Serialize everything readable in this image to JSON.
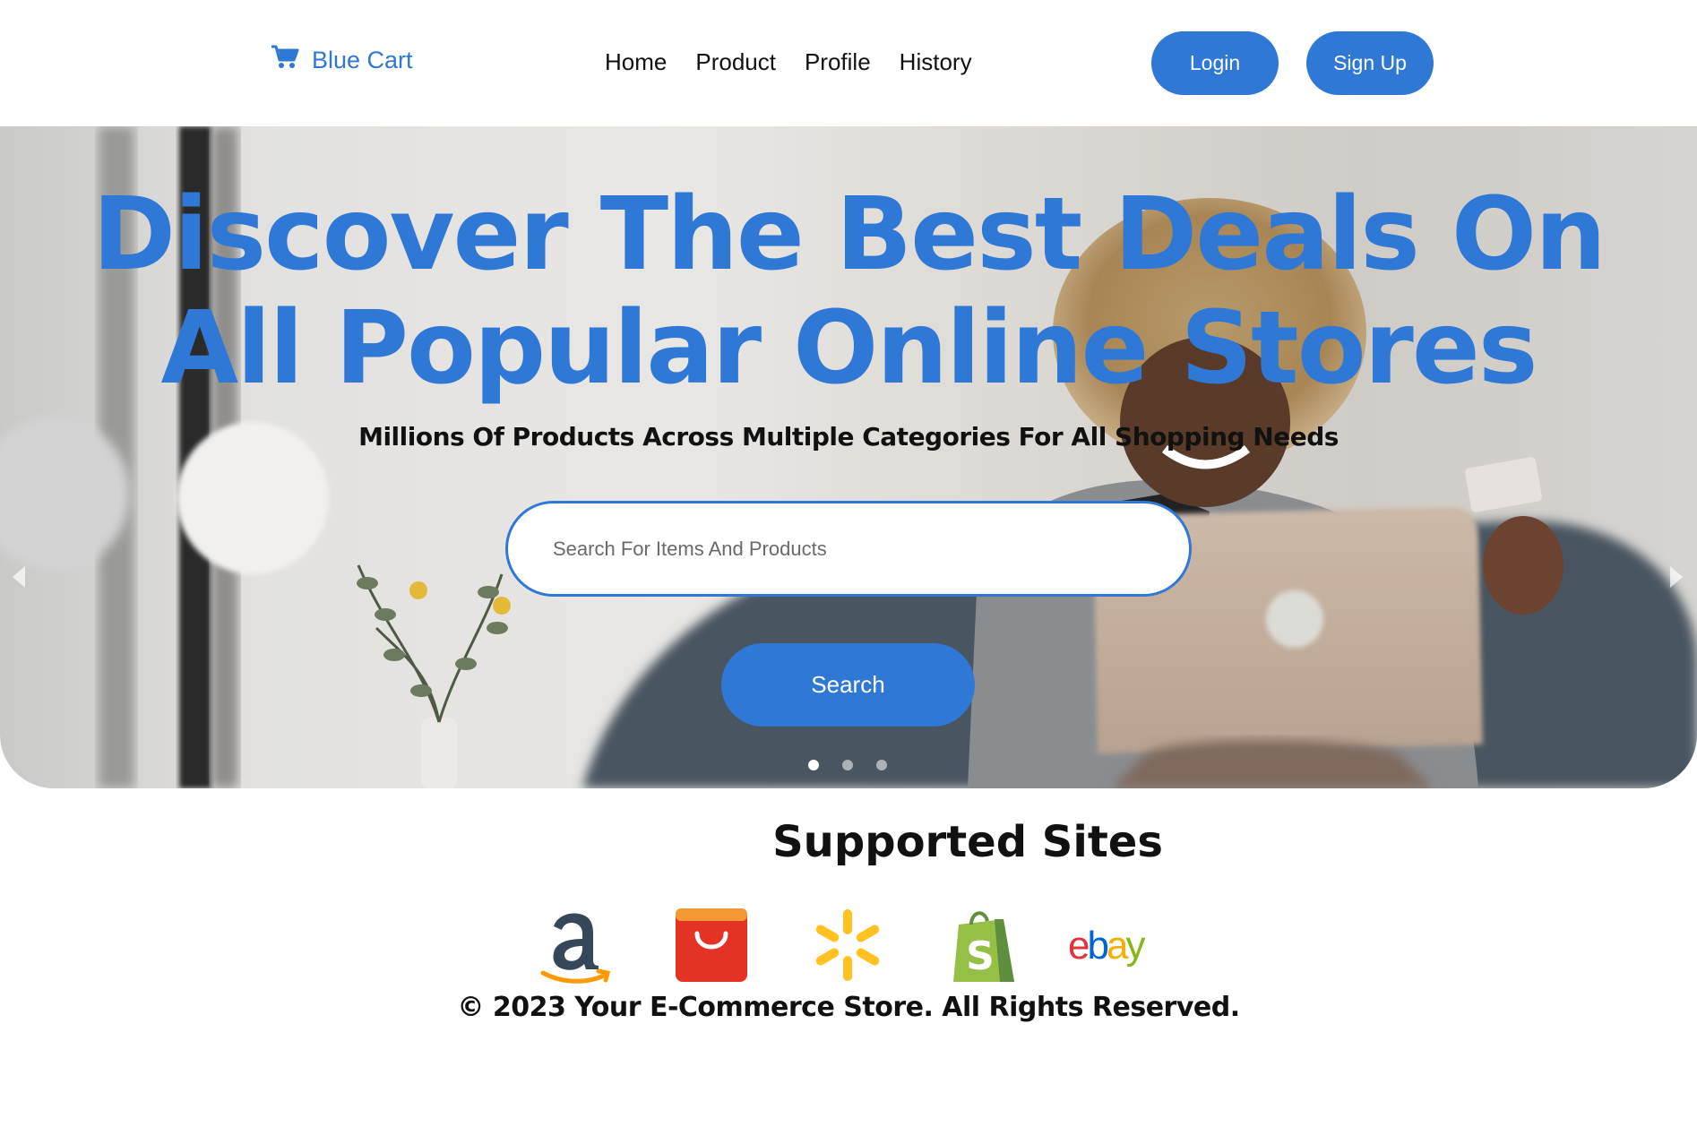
{
  "brand": {
    "name": "Blue Cart",
    "icon": "cart-icon"
  },
  "nav": {
    "items": [
      "Home",
      "Product",
      "Profile",
      "History"
    ]
  },
  "auth": {
    "login_label": "Login",
    "signup_label": "Sign Up"
  },
  "hero": {
    "title_line1": "Discover The Best Deals On",
    "title_line2": "All Popular Online Stores",
    "subtitle": "Millions Of Products Across Multiple Categories For All Shopping Needs",
    "search_placeholder": "Search For Items And Products",
    "search_button": "Search",
    "slide_count": 3,
    "active_slide": 1
  },
  "supported": {
    "title": "Supported Sites",
    "sites": [
      {
        "name": "Amazon",
        "icon": "amazon-logo-icon"
      },
      {
        "name": "AliExpress",
        "icon": "aliexpress-bag-icon"
      },
      {
        "name": "Walmart",
        "icon": "walmart-spark-icon"
      },
      {
        "name": "Shopify",
        "icon": "shopify-bag-icon"
      },
      {
        "name": "eBay",
        "icon": "ebay-logo-icon"
      }
    ]
  },
  "footer": {
    "text": "© 2023 Your E-Commerce Store. All Rights Reserved."
  },
  "colors": {
    "accent": "#2f78d6",
    "text": "#111111",
    "background": "#ffffff"
  }
}
